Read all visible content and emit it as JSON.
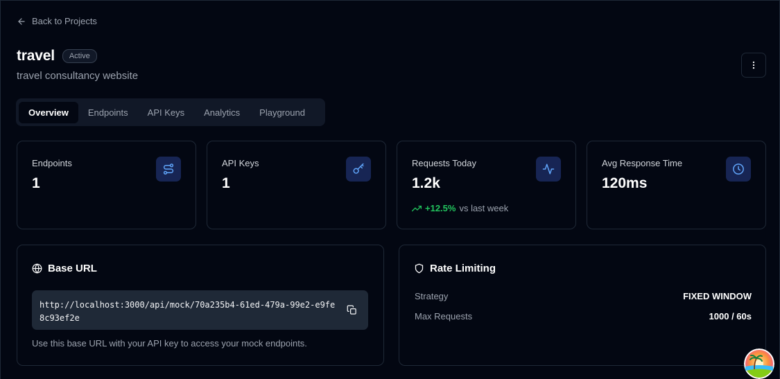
{
  "nav": {
    "back_label": "Back to Projects"
  },
  "project": {
    "name": "travel",
    "status": "Active",
    "description": "travel consultancy website"
  },
  "tabs": [
    {
      "label": "Overview",
      "active": true
    },
    {
      "label": "Endpoints",
      "active": false
    },
    {
      "label": "API Keys",
      "active": false
    },
    {
      "label": "Analytics",
      "active": false
    },
    {
      "label": "Playground",
      "active": false
    }
  ],
  "stats": [
    {
      "label": "Endpoints",
      "value": "1",
      "icon": "route-icon"
    },
    {
      "label": "API Keys",
      "value": "1",
      "icon": "key-icon"
    },
    {
      "label": "Requests Today",
      "value": "1.2k",
      "icon": "activity-icon",
      "trend_pct": "+12.5%",
      "trend_text": "vs last week"
    },
    {
      "label": "Avg Response Time",
      "value": "120ms",
      "icon": "clock-icon"
    }
  ],
  "base_url": {
    "title": "Base URL",
    "url": "http://localhost:3000/api/mock/70a235b4-61ed-479a-99e2-e9fe8c93ef2e",
    "help": "Use this base URL with your API key to access your mock endpoints."
  },
  "rate_limiting": {
    "title": "Rate Limiting",
    "rows": [
      {
        "label": "Strategy",
        "value": "FIXED WINDOW"
      },
      {
        "label": "Max Requests",
        "value": "1000 / 60s"
      }
    ]
  },
  "colors": {
    "background": "#030712",
    "accent": "#3b82f6",
    "positive": "#22c55e",
    "muted": "#9ca3af"
  }
}
